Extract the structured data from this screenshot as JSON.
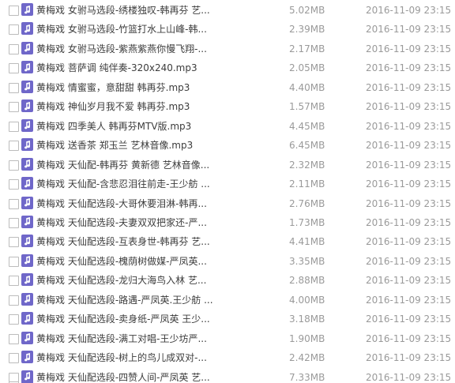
{
  "colors": {
    "file_icon": "#6f67c9",
    "name_text": "#3c3c3c",
    "meta_text": "#9a9a9a",
    "checkbox_border": "#bcbcbc"
  },
  "icons": {
    "file": "music-note-icon",
    "checkbox": "checkbox-icon"
  },
  "files": [
    {
      "name": "黄梅戏 女驸马选段-绣楼独叹-韩再芬 艺...",
      "size": "5.02MB",
      "date": "2016-11-09 23:15"
    },
    {
      "name": "黄梅戏 女驸马选段-竹篮打水上山峰-韩...",
      "size": "2.39MB",
      "date": "2016-11-09 23:15"
    },
    {
      "name": "黄梅戏 女驸马选段-紫燕紫燕你慢飞翔-...",
      "size": "2.17MB",
      "date": "2016-11-09 23:15"
    },
    {
      "name": "黄梅戏 菩萨调 纯伴奏-320x240.mp3",
      "size": "2.05MB",
      "date": "2016-11-09 23:15"
    },
    {
      "name": "黄梅戏 情蜜蜜，意甜甜 韩再芬.mp3",
      "size": "4.40MB",
      "date": "2016-11-09 23:15"
    },
    {
      "name": "黄梅戏 神仙岁月我不爱 韩再芬.mp3",
      "size": "1.57MB",
      "date": "2016-11-09 23:15"
    },
    {
      "name": "黄梅戏 四季美人 韩再芬MTV版.mp3",
      "size": "4.45MB",
      "date": "2016-11-09 23:15"
    },
    {
      "name": "黄梅戏 送香茶 郑玉兰 艺林音像.mp3",
      "size": "6.45MB",
      "date": "2016-11-09 23:15"
    },
    {
      "name": "黄梅戏 天仙配-韩再芬 黄新德 艺林音像...",
      "size": "2.32MB",
      "date": "2016-11-09 23:15"
    },
    {
      "name": "黄梅戏 天仙配-含悲忍泪往前走-王少舫 ...",
      "size": "2.11MB",
      "date": "2016-11-09 23:15"
    },
    {
      "name": "黄梅戏 天仙配选段-大哥休要泪淋-韩再...",
      "size": "2.76MB",
      "date": "2016-11-09 23:15"
    },
    {
      "name": "黄梅戏 天仙配选段-夫妻双双把家还-严...",
      "size": "1.73MB",
      "date": "2016-11-09 23:15"
    },
    {
      "name": "黄梅戏 天仙配选段-互表身世-韩再芬 艺...",
      "size": "4.41MB",
      "date": "2016-11-09 23:15"
    },
    {
      "name": "黄梅戏 天仙配选段-槐荫树做媒-严凤英...",
      "size": "3.35MB",
      "date": "2016-11-09 23:15"
    },
    {
      "name": "黄梅戏 天仙配选段-龙归大海鸟入林 艺...",
      "size": "2.88MB",
      "date": "2016-11-09 23:15"
    },
    {
      "name": "黄梅戏 天仙配选段-路遇-严凤英.王少舫 ...",
      "size": "4.00MB",
      "date": "2016-11-09 23:15"
    },
    {
      "name": "黄梅戏 天仙配选段-卖身纸-严凤英 王少...",
      "size": "3.18MB",
      "date": "2016-11-09 23:15"
    },
    {
      "name": "黄梅戏 天仙配选段-满工对唱-王少坊严...",
      "size": "1.90MB",
      "date": "2016-11-09 23:15"
    },
    {
      "name": "黄梅戏 天仙配选段-树上的鸟儿成双对-...",
      "size": "2.42MB",
      "date": "2016-11-09 23:15"
    },
    {
      "name": "黄梅戏 天仙配选段-四赞人间-严凤英 艺...",
      "size": "7.33MB",
      "date": "2016-11-09 23:15"
    }
  ]
}
